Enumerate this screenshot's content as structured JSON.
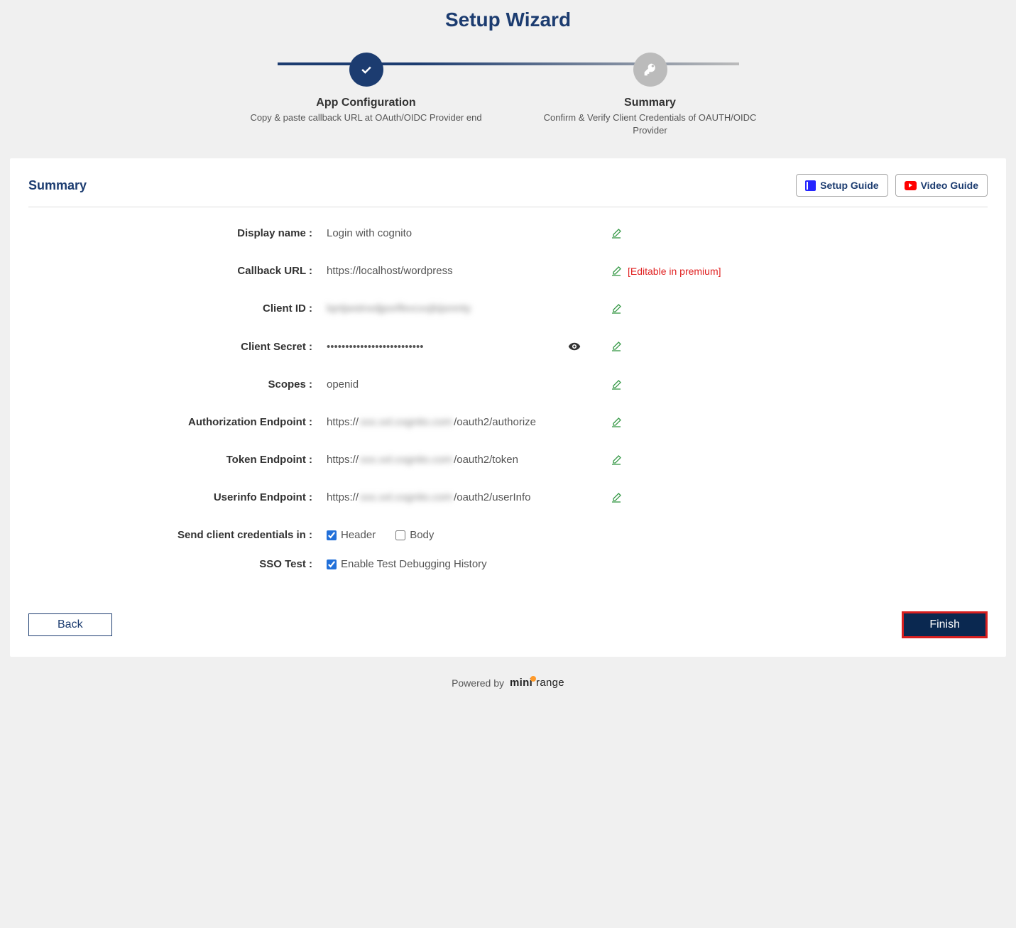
{
  "title": "Setup Wizard",
  "steps": {
    "left": {
      "title": "App Configuration",
      "desc": "Copy & paste callback URL at OAuth/OIDC Provider end"
    },
    "right": {
      "title": "Summary",
      "desc": "Confirm & Verify Client Credentials of OAUTH/OIDC Provider"
    }
  },
  "card": {
    "title": "Summary",
    "setup_guide": "Setup Guide",
    "video_guide": "Video Guide",
    "premium_note": "[Editable in premium]"
  },
  "labels": {
    "display_name": "Display name :",
    "callback_url": "Callback URL :",
    "client_id": "Client ID :",
    "client_secret": "Client Secret :",
    "scopes": "Scopes :",
    "auth_endpoint": "Authorization Endpoint :",
    "token_endpoint": "Token Endpoint :",
    "userinfo_endpoint": "Userinfo Endpoint :",
    "send_creds": "Send client credentials in :",
    "sso_test": "SSO Test :"
  },
  "values": {
    "display_name": "Login with cognito",
    "callback_url": "https://localhost/wordpress",
    "client_id_blur": "lqntjwstnxdjporlfevcxxjbijsnmty",
    "client_secret": "••••••••••••••••••••••••••",
    "scopes": "openid",
    "ep_prefix": "https://",
    "ep_blur": "xxx.xxl.cognito.com",
    "auth_suffix": "/oauth2/authorize",
    "token_suffix": "/oauth2/token",
    "userinfo_suffix": "/oauth2/userInfo"
  },
  "checkboxes": {
    "header": "Header",
    "body": "Body",
    "sso_label": "Enable Test Debugging History",
    "header_checked": true,
    "body_checked": false,
    "sso_checked": true
  },
  "buttons": {
    "back": "Back",
    "finish": "Finish"
  },
  "footer": {
    "powered": "Powered by"
  }
}
